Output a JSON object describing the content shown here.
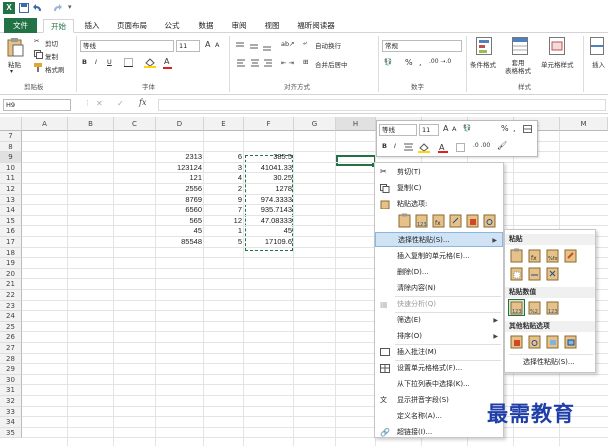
{
  "title_bar": {
    "logo": "X",
    "quick_access": [
      "save",
      "undo",
      "redo",
      "customize"
    ]
  },
  "tabs": [
    "文件",
    "开始",
    "插入",
    "页面布局",
    "公式",
    "数据",
    "审阅",
    "视图",
    "福昕阅读器"
  ],
  "ribbon": {
    "clipboard": {
      "paste": "粘贴",
      "cut": "剪切",
      "copy": "复制",
      "format_painter": "格式刷",
      "label": "剪贴板"
    },
    "font": {
      "name": "等线",
      "size": "11",
      "bold": "B",
      "italic": "I",
      "underline": "U",
      "label": "字体",
      "grow": "A",
      "shrink": "A",
      "font_color": "A"
    },
    "alignment": {
      "wrap": "自动换行",
      "merge": "合并后居中",
      "label": "对齐方式"
    },
    "number": {
      "format": "常规",
      "percent": "%",
      "comma": ",",
      "label": "数字"
    },
    "styles": {
      "cond": "条件格式",
      "table": "套用\n表格格式",
      "cell": "单元格样式",
      "label": "样式"
    },
    "insert": "插入"
  },
  "formula_bar": {
    "namebox": "H9",
    "fx": "fx",
    "content": ""
  },
  "columns": [
    "A",
    "B",
    "C",
    "D",
    "E",
    "F",
    "G",
    "H",
    "I",
    "J",
    "K",
    "L",
    "M"
  ],
  "rows": [
    "7",
    "8",
    "9",
    "10",
    "11",
    "12",
    "13",
    "14",
    "15",
    "16",
    "17",
    "18",
    "19",
    "20",
    "21",
    "22",
    "23",
    "24",
    "25",
    "26",
    "27",
    "28",
    "29",
    "30",
    "31",
    "32",
    "33",
    "34",
    "35"
  ],
  "cells": {
    "D": [
      "2313",
      "123124",
      "121",
      "2556",
      "8769",
      "6560",
      "565",
      "45",
      "85548"
    ],
    "E": [
      "6",
      "3",
      "4",
      "2",
      "9",
      "7",
      "12",
      "1",
      "5"
    ],
    "F": [
      "385.5",
      "41041.33",
      "30.25",
      "1278",
      "974.3333",
      "935.7143",
      "47.08333",
      "45",
      "17109.6"
    ]
  },
  "mini_toolbar": {
    "font": "等线",
    "size": "11",
    "grow": "A",
    "shrink": "A",
    "percent": "%",
    "comma": ",",
    "bold": "B",
    "italic": "I"
  },
  "context_menu": {
    "cut": "剪切(T)",
    "copy": "复制(C)",
    "paste_options": "粘贴选项:",
    "paste_special": "选择性粘贴(S)...",
    "insert_copied": "插入复制的单元格(E)...",
    "delete": "删除(D)...",
    "clear": "清除内容(N)",
    "quick_analysis": "快速分析(Q)",
    "filter": "筛选(E)",
    "sort": "排序(O)",
    "insert_comment": "插入批注(M)",
    "format_cells": "设置单元格格式(F)...",
    "pick_list": "从下拉列表中选择(K)...",
    "phonetic": "显示拼音字段(S)",
    "define_name": "定义名称(A)...",
    "hyperlink": "超链接(I)..."
  },
  "submenu": {
    "paste": "粘贴",
    "paste_values": "粘贴数值",
    "other": "其他粘贴选项",
    "special": "选择性粘贴(S)..."
  },
  "watermark": "最需教育",
  "colors": {
    "excel_green": "#217346",
    "highlight": "#cfe3f5",
    "watermark": "#1f3ea8"
  }
}
